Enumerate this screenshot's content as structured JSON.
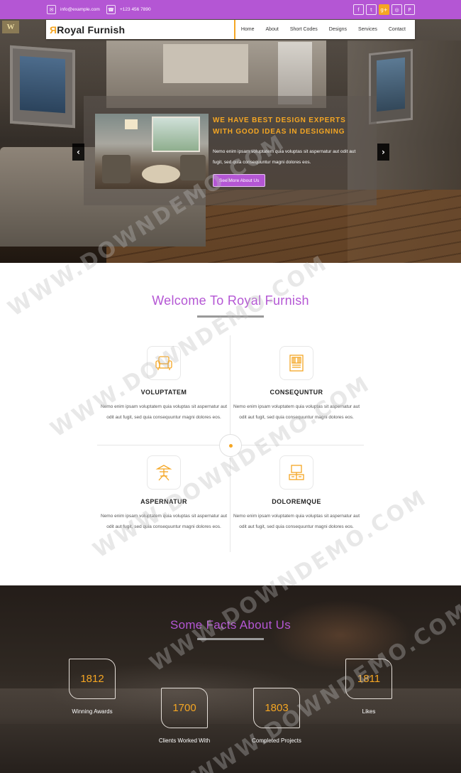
{
  "topbar": {
    "email": "info@example.com",
    "phone": "+123 456 7890",
    "social": [
      {
        "icon": "facebook-icon",
        "glyph": "f"
      },
      {
        "icon": "twitter-icon",
        "glyph": "t"
      },
      {
        "icon": "google-plus-icon",
        "glyph": "g+"
      },
      {
        "icon": "dribbble-icon",
        "glyph": "◎"
      },
      {
        "icon": "pinterest-icon",
        "glyph": "P"
      }
    ]
  },
  "logo_corner": "W",
  "brand": {
    "mark": "Я",
    "name": "Royal Furnish"
  },
  "nav": [
    "Home",
    "About",
    "Short Codes",
    "Designs",
    "Services",
    "Contact"
  ],
  "slider": {
    "title": "WE HAVE BEST DESIGN EXPERTS WITH GOOD IDEAS IN DESIGNING",
    "text": "Nemo enim ipsam voluptatem quia voluptas sit aspernatur aut odit aut fugit, sed quia consequuntur magni dolores eos.",
    "button": "See More About Us",
    "prev": "‹",
    "next": "›"
  },
  "welcome": {
    "title": "Welcome To Royal Furnish",
    "features": [
      {
        "title": "VOLUPTATEM",
        "text": "Nemo enim ipsam voluptatem quia voluptas sit aspernatur aut odit aut fugit, sed quia consequuntur magni dolores eos.",
        "icon": "armchair-icon"
      },
      {
        "title": "CONSEQUNTUR",
        "text": "Nemo enim ipsam voluptatem quia voluptas sit aspernatur aut odit aut fugit, sed quia consequuntur magni dolores eos.",
        "icon": "wardrobe-icon"
      },
      {
        "title": "ASPERNATUR",
        "text": "Nemo enim ipsam voluptatem quia voluptas sit aspernatur aut odit aut fugit, sed quia consequuntur magni dolores eos.",
        "icon": "parasol-table-icon"
      },
      {
        "title": "DOLOREMQUE",
        "text": "Nemo enim ipsam voluptatem quia voluptas sit aspernatur aut odit aut fugit, sed quia consequuntur magni dolores eos.",
        "icon": "tv-stand-icon"
      }
    ]
  },
  "facts": {
    "title": "Some Facts About Us",
    "items": [
      {
        "value": "1812",
        "label": "Winning Awards"
      },
      {
        "value": "1700",
        "label": "Clients Worked With"
      },
      {
        "value": "1803",
        "label": "Completed Projects"
      },
      {
        "value": "1811",
        "label": "Likes"
      }
    ]
  },
  "watermark": "WWW.DOWNDEMO.COM",
  "colors": {
    "accent_purple": "#b456d4",
    "accent_orange": "#f5a623"
  }
}
